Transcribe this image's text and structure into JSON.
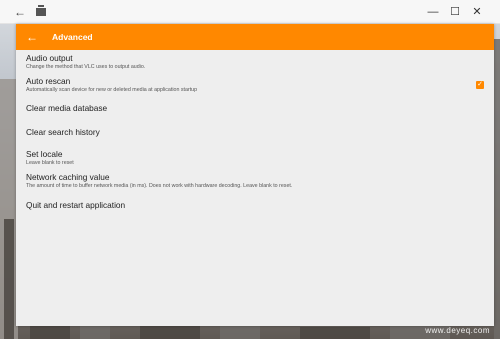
{
  "window": {
    "controls": {
      "minimize": "—",
      "maximize": "☐",
      "close": "✕"
    }
  },
  "appbar": {
    "title": "Advanced"
  },
  "settings": [
    {
      "title": "Audio output",
      "summary": "Change the method that VLC uses to output audio."
    },
    {
      "title": "Auto rescan",
      "summary": "Automatically scan device for new or deleted media at application startup",
      "checked": true
    },
    {
      "title": "Clear media database",
      "summary": ""
    },
    {
      "title": "Clear search history",
      "summary": ""
    },
    {
      "title": "Set locale",
      "summary": "Leave blank to reset"
    },
    {
      "title": "Network caching value",
      "summary": "The amount of time to buffer network media (in ms). Does not work with hardware decoding. Leave blank to reset."
    },
    {
      "title": "Quit and restart application",
      "summary": ""
    }
  ],
  "watermark": "www.deyeq.com",
  "colors": {
    "accent": "#ff8800",
    "background": "#eeeeee"
  }
}
